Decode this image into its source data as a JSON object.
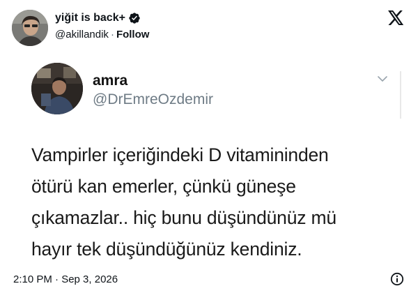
{
  "author": {
    "display_name": "yiğit is back+",
    "handle": "@akillandik",
    "separator": "·",
    "follow_label": "Follow",
    "verified": true,
    "verified_color": "#0f1419"
  },
  "brand": {
    "logo_icon": "x-logo-icon"
  },
  "quoted_tweet": {
    "display_name": "amra",
    "handle": "@DrEmreOzdemir",
    "menu_icon": "chevron-down-icon",
    "text_lines": [
      "Vampirler içeriğindeki D vitamininden",
      "ötürü kan emerler, çünkü güneşe",
      "çıkamazlar.. hiç  bunu düşündünüz mü",
      "hayır tek düşündüğünüz kendiniz."
    ]
  },
  "footer": {
    "timestamp": "2:10 PM · Sep 3, 2026",
    "info_icon": "info-icon"
  },
  "colors": {
    "text_primary": "#0f1419",
    "text_secondary": "#536471",
    "quoted_handle": "#6e7b85",
    "background": "#ffffff"
  }
}
